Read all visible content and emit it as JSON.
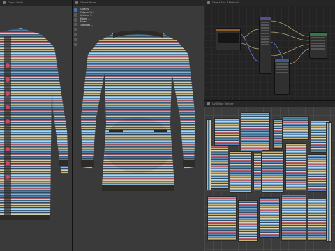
{
  "viewport_left": {
    "header_text": "Object Mode"
  },
  "viewport_mid": {
    "header_text": "Object Mode",
    "stats": {
      "title": "Objects",
      "lines": [
        "Objects   1 / 4",
        "Vertices   ...",
        "Edges   ...",
        "Faces   ...",
        "Triangles   ..."
      ]
    }
  },
  "node_editor": {
    "header_text": "Object  Slot 1  Material"
  },
  "uv_editor": {
    "header_text": "UV Editor  Texture"
  },
  "colors": {
    "accent": "#4772b3",
    "fabric_blue": "#5b86b8",
    "fabric_cream": "#c9b47c",
    "fabric_red": "#b65f6a",
    "trim": "#2e2a25"
  }
}
